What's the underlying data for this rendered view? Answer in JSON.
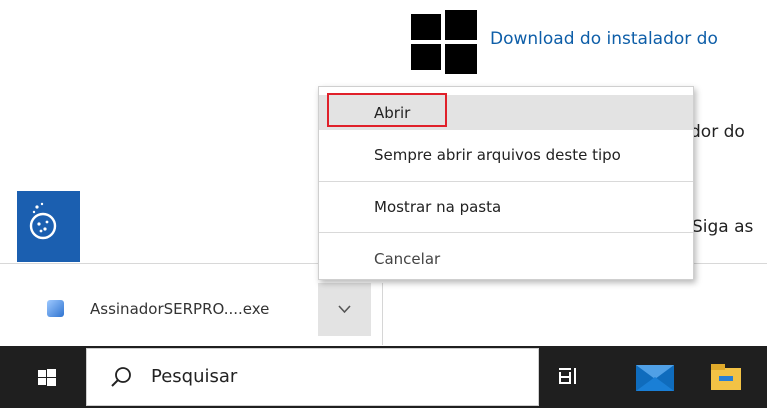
{
  "page": {
    "link_download": "Download do instalador do",
    "partial_text_2": "dor do",
    "partial_text_3": "Siga as"
  },
  "download_bar": {
    "file_name": "AssinadorSERPRO....exe",
    "menu_button_icon": "chevron-down-icon",
    "file_icon": "installer-icon"
  },
  "context_menu": {
    "items": [
      {
        "label": "Abrir"
      },
      {
        "label": "Sempre abrir arquivos deste tipo"
      },
      {
        "label": "Mostrar na pasta"
      },
      {
        "label": "Cancelar"
      }
    ]
  },
  "taskbar": {
    "search_placeholder": "Pesquisar",
    "icons": [
      "windows-start-icon",
      "search-icon",
      "task-view-icon",
      "mail-icon",
      "file-explorer-icon"
    ]
  },
  "colors": {
    "link": "#0e5ea8",
    "highlight_box": "#e0202a",
    "taskbar": "#1f1f1f",
    "app_tile": "#1b5fb0"
  }
}
